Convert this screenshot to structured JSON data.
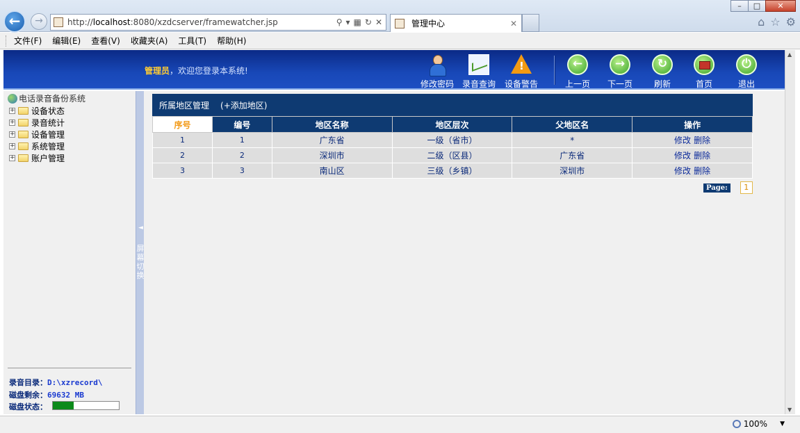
{
  "browser": {
    "url_prefix": "http://",
    "url_host": "localhost",
    "url_rest": ":8080/xzdcserver/framewatcher.jsp",
    "tab_title": "管理中心",
    "window_buttons": [
      "–",
      "□",
      "✕"
    ],
    "zoom": "100%",
    "zoom_dropdown": "▼"
  },
  "menubar": {
    "items": [
      "文件(F)",
      "编辑(E)",
      "查看(V)",
      "收藏夹(A)",
      "工具(T)",
      "帮助(H)"
    ]
  },
  "header": {
    "role": "管理员",
    "welcome": "，欢迎您登录本系统!",
    "buttons": [
      {
        "label": "修改密码",
        "icon": "user-icon"
      },
      {
        "label": "录音查询",
        "icon": "chart-icon"
      },
      {
        "label": "设备警告",
        "icon": "warning-icon"
      },
      {
        "label": "上一页",
        "icon": "arrow-left-icon"
      },
      {
        "label": "下一页",
        "icon": "arrow-right-icon"
      },
      {
        "label": "刷新",
        "icon": "refresh-icon"
      },
      {
        "label": "首页",
        "icon": "home-icon"
      },
      {
        "label": "退出",
        "icon": "power-icon"
      }
    ]
  },
  "sidebar": {
    "root": "电话录音备份系统",
    "nodes": [
      "设备状态",
      "录音统计",
      "设备管理",
      "系统管理",
      "账户管理"
    ],
    "record_dir_label": "录音目录：",
    "record_dir_value": "D:\\xzrecord\\",
    "disk_free_label": "磁盘剩余：",
    "disk_free_value": "69632 MB",
    "disk_status_label": "磁盘状态：",
    "disk_usage_fraction": 0.32
  },
  "splitter": {
    "arrow": "◄",
    "text": "屏幕切换"
  },
  "main": {
    "panel_title": "所属地区管理",
    "add_link": "(+添加地区)",
    "columns": [
      "序号",
      "编号",
      "地区名称",
      "地区层次",
      "父地区名",
      "操作"
    ],
    "rows": [
      {
        "seq": "1",
        "code": "1",
        "name": "广东省",
        "level": "一级（省市）",
        "parent": "*"
      },
      {
        "seq": "2",
        "code": "2",
        "name": "深圳市",
        "level": "二级（区县）",
        "parent": "广东省"
      },
      {
        "seq": "3",
        "code": "3",
        "name": "南山区",
        "level": "三级（乡镇）",
        "parent": "深圳市"
      }
    ],
    "edit_label": "修改",
    "delete_label": "删除",
    "pager_label": "Page:",
    "current_page": "1"
  },
  "colors": {
    "header_blue": "#1848b8",
    "table_header": "#0e3a72",
    "accent_orange": "#f29a18",
    "disk_green": "#0c8a1a"
  }
}
